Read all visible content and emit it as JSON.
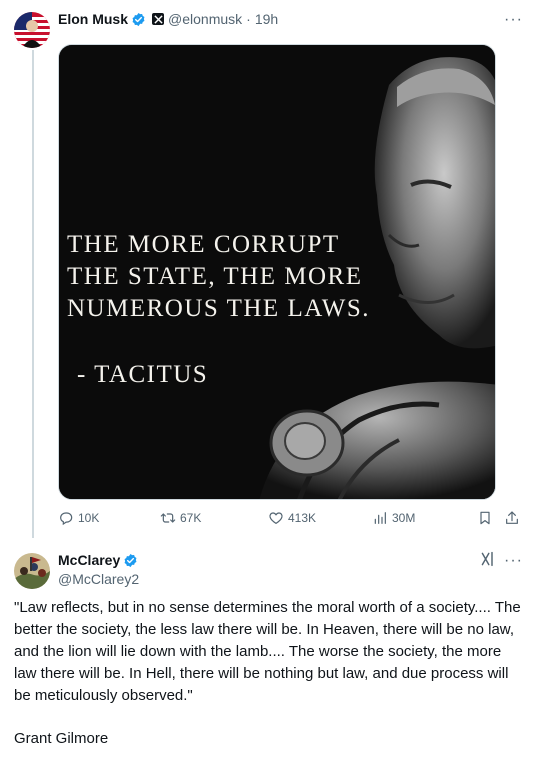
{
  "post": {
    "author_name": "Elon Musk",
    "handle": "@elonmusk",
    "separator": "·",
    "time": "19h",
    "more_label": "···",
    "image_quote": {
      "lines": [
        "THE MORE CORRUPT",
        "THE STATE, THE MORE",
        "NUMEROUS THE LAWS."
      ],
      "attribution": "- TACITUS"
    },
    "actions": {
      "replies": "10K",
      "reposts": "67K",
      "likes": "413K",
      "views": "30M"
    }
  },
  "reply": {
    "author_name": "McClarey",
    "handle": "@McClarey2",
    "more_label": "···",
    "body": "\"Law reflects, but in no sense determines the moral worth of a society.... The better the society, the less law there will be. In Heaven, there  will be no law, and the lion will lie down with the lamb.... The worse the  society, the more law there will be. In Hell, there will be nothing but  law, and due process will be meticulously observed.\"",
    "signature": "Grant Gilmore"
  },
  "colors": {
    "verified": "#1d9bf0",
    "secondary_text": "#536471",
    "thread_line": "#cfd9de"
  },
  "icons": [
    "verified-badge-icon",
    "x-affiliate-icon",
    "more-icon",
    "reply-icon",
    "repost-icon",
    "like-icon",
    "views-icon",
    "bookmark-icon",
    "share-icon",
    "grok-icon"
  ]
}
